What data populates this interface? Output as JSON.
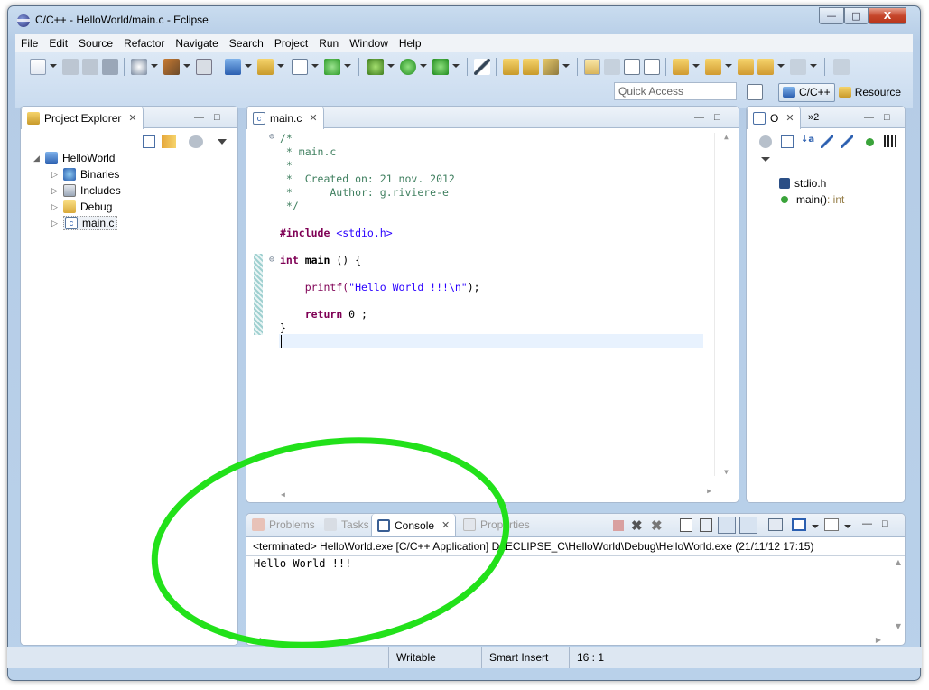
{
  "window": {
    "title": "C/C++ - HelloWorld/main.c - Eclipse",
    "minimize": "—",
    "maximize": "□",
    "close": "X"
  },
  "menu": [
    "File",
    "Edit",
    "Source",
    "Refactor",
    "Navigate",
    "Search",
    "Project",
    "Run",
    "Window",
    "Help"
  ],
  "quick_access": {
    "placeholder": "Quick Access"
  },
  "perspectives": [
    {
      "label": "C/C++",
      "active": true
    },
    {
      "label": "Resource",
      "active": false
    }
  ],
  "project_explorer": {
    "tab_label": "Project Explorer",
    "project": "HelloWorld",
    "items": [
      "Binaries",
      "Includes",
      "Debug",
      "main.c"
    ]
  },
  "editor": {
    "tab_label": "main.c",
    "lines": [
      "/*",
      " * main.c",
      " *",
      " *  Created on: 21 nov. 2012",
      " *      Author: g.riviere-e",
      " */",
      "",
      "#include <stdio.h>",
      "",
      "int main () {",
      "",
      "    printf(\"Hello World !!!\\n\");",
      "",
      "    return 0 ;",
      "}"
    ]
  },
  "outline": {
    "tab_label": "O",
    "overflow": "»2",
    "items": [
      {
        "label": "stdio.h",
        "type": ""
      },
      {
        "label": "main()",
        "type": " : int"
      }
    ]
  },
  "bottom_panel": {
    "tabs": [
      {
        "label": "Problems",
        "active": false
      },
      {
        "label": "Tasks",
        "active": false
      },
      {
        "label": "Console",
        "active": true
      },
      {
        "label": "Properties",
        "active": false
      }
    ],
    "console_header": "<terminated> HelloWorld.exe [C/C++ Application] D:\\ECLIPSE_C\\HelloWorld\\Debug\\HelloWorld.exe (21/11/12 17:15)",
    "console_output": "Hello World !!!"
  },
  "status": {
    "writable": "Writable",
    "insert_mode": "Smart Insert",
    "position": "16 : 1"
  },
  "colors": {
    "annotation": "#22e11a",
    "keyword": "#7f0055",
    "comment": "#3f7f5f",
    "string": "#2a00ff"
  }
}
